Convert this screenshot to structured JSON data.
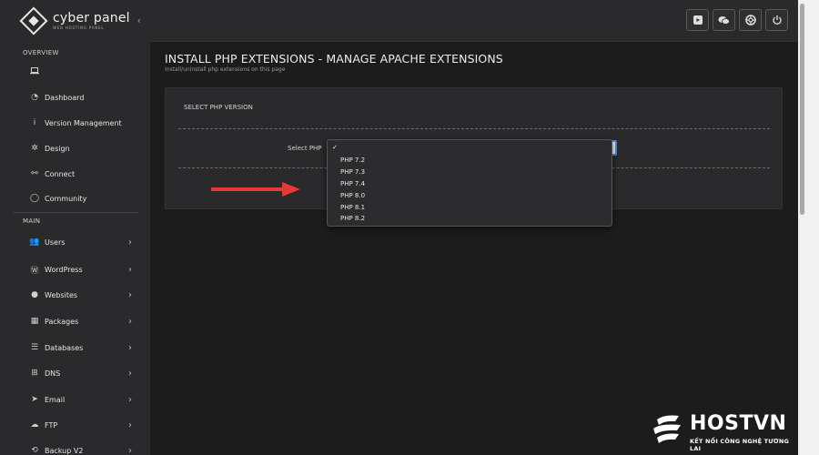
{
  "logo": {
    "title": "cyber panel",
    "subtitle": "WEB HOSTING PANEL"
  },
  "sidebar": {
    "collapse_icon": "chevron-left-icon",
    "overview_label": "OVERVIEW",
    "main_label": "MAIN",
    "overview_items": [
      {
        "label": "",
        "icon": "laptop-icon"
      },
      {
        "label": "Dashboard",
        "icon": "tachometer-icon"
      },
      {
        "label": "Version Management",
        "icon": "info-icon"
      },
      {
        "label": "Design",
        "icon": "cog-icon"
      },
      {
        "label": "Connect",
        "icon": "link-icon"
      },
      {
        "label": "Community",
        "icon": "chat-icon"
      }
    ],
    "main_items": [
      {
        "label": "Users",
        "icon": "users-icon"
      },
      {
        "label": "WordPress",
        "icon": "wordpress-icon"
      },
      {
        "label": "Websites",
        "icon": "globe-icon"
      },
      {
        "label": "Packages",
        "icon": "cubes-icon"
      },
      {
        "label": "Databases",
        "icon": "database-icon"
      },
      {
        "label": "DNS",
        "icon": "sitemap-icon"
      },
      {
        "label": "Email",
        "icon": "paper-plane-icon"
      },
      {
        "label": "FTP",
        "icon": "cloud-upload-icon"
      },
      {
        "label": "Backup V2",
        "icon": "backup-icon"
      }
    ]
  },
  "topbar": {
    "buttons": [
      "youtube-icon",
      "chat-icon",
      "support-icon",
      "power-icon"
    ]
  },
  "main": {
    "title": "INSTALL PHP EXTENSIONS - MANAGE APACHE EXTENSIONS",
    "subtitle": "Install/uninstall php extensions on this page",
    "panel_title": "SELECT PHP VERSION",
    "select_label": "Select PHP",
    "dropdown_check": "✓",
    "options": [
      "PHP 7.2",
      "PHP 7.3",
      "PHP 7.4",
      "PHP 8.0",
      "PHP 8.1",
      "PHP 8.2"
    ]
  },
  "brand": {
    "name": "HOSTVN",
    "tagline": "KẾT NỐI CÔNG NGHỆ TƯƠNG LAI"
  },
  "colors": {
    "sidebar": "#2a2a2c",
    "background": "#1c1c1d",
    "select_border": "#4c8ad6",
    "arrow": "#e53935"
  }
}
